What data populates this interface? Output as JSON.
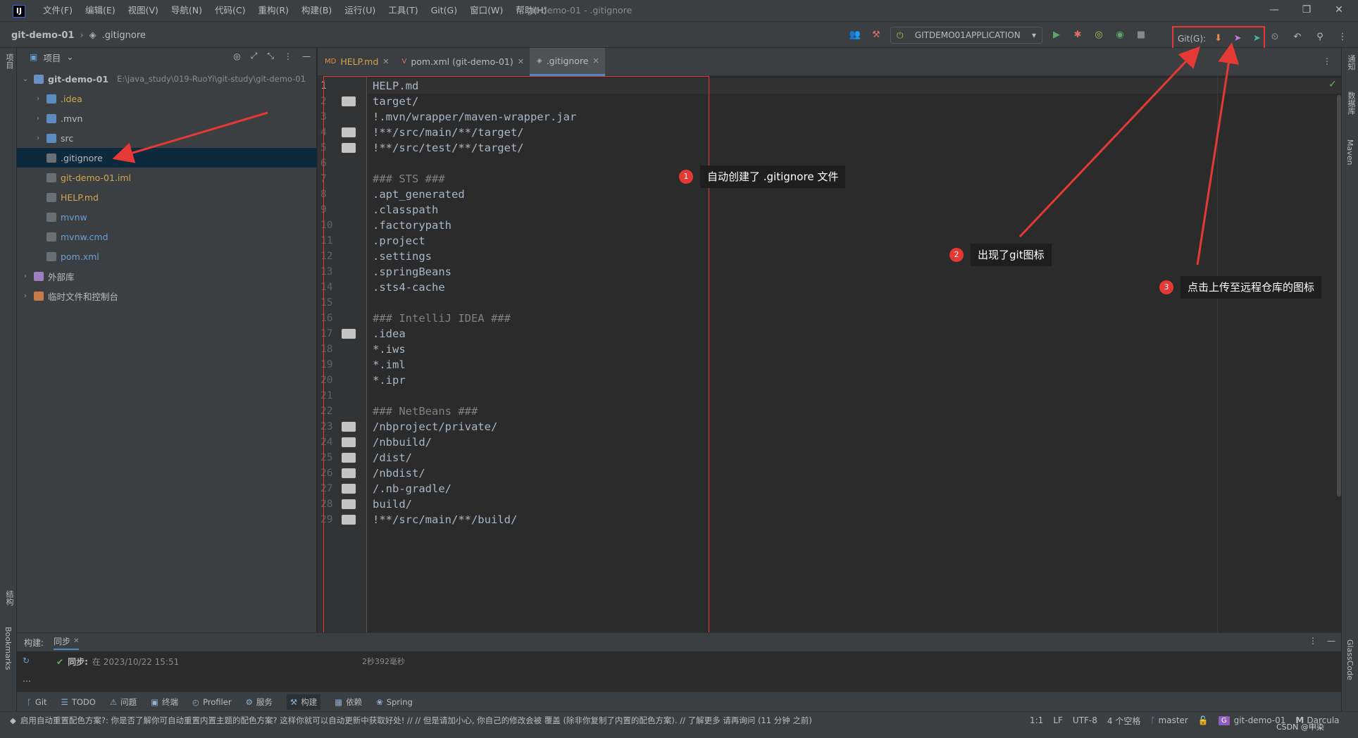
{
  "window": {
    "title": "git-demo-01 - .gitignore",
    "menu": [
      "文件(F)",
      "编辑(E)",
      "视图(V)",
      "导航(N)",
      "代码(C)",
      "重构(R)",
      "构建(B)",
      "运行(U)",
      "工具(T)",
      "Git(G)",
      "窗口(W)",
      "帮助(H)"
    ],
    "controls": {
      "minimize": "—",
      "restore": "❐",
      "close": "✕"
    }
  },
  "navbar": {
    "project": "git-demo-01",
    "file": ".gitignore",
    "run_config": "GITDEMO01APPLICATION",
    "git_label": "Git(G):"
  },
  "left_stripe": {
    "project_label": "项目",
    "structure_label": "结构",
    "bookmarks_label": "Bookmarks"
  },
  "right_stripe": {
    "notifications": "通知",
    "database": "数据库",
    "maven": "Maven",
    "glasscode": "GlassCode"
  },
  "project_panel": {
    "title": "项目",
    "root": {
      "name": "git-demo-01",
      "path": "E:\\java_study\\019-RuoYi\\git-study\\git-demo-01"
    },
    "items": [
      {
        "name": ".idea",
        "type": "folder",
        "expandable": true,
        "color": "#d0a750"
      },
      {
        "name": ".mvn",
        "type": "folder",
        "expandable": true,
        "color": "#bbbbbb"
      },
      {
        "name": "src",
        "type": "folder",
        "expandable": true,
        "color": "#bbbbbb"
      },
      {
        "name": ".gitignore",
        "type": "file",
        "expandable": false,
        "color": "#bbbbbb",
        "selected": true
      },
      {
        "name": "git-demo-01.iml",
        "type": "file",
        "expandable": false,
        "color": "#d0a750"
      },
      {
        "name": "HELP.md",
        "type": "file",
        "expandable": false,
        "color": "#d0a750"
      },
      {
        "name": "mvnw",
        "type": "file",
        "expandable": false,
        "color": "#6a9fd4"
      },
      {
        "name": "mvnw.cmd",
        "type": "file",
        "expandable": false,
        "color": "#6a9fd4"
      },
      {
        "name": "pom.xml",
        "type": "file",
        "expandable": false,
        "color": "#6a9fd4"
      }
    ],
    "external_libs": "外部库",
    "scratches": "临时文件和控制台"
  },
  "tabs": [
    {
      "label": "HELP.md",
      "active": false
    },
    {
      "label": "pom.xml (git-demo-01)",
      "active": false
    },
    {
      "label": ".gitignore",
      "active": true
    }
  ],
  "editor": {
    "lines": [
      {
        "n": "1",
        "text": "HELP.md",
        "folder": false,
        "comment": false
      },
      {
        "n": "2",
        "text": "target/",
        "folder": true,
        "comment": false
      },
      {
        "n": "3",
        "text": "!.mvn/wrapper/maven-wrapper.jar",
        "folder": false,
        "comment": false
      },
      {
        "n": "4",
        "text": "!**/src/main/**/target/",
        "folder": true,
        "comment": false
      },
      {
        "n": "5",
        "text": "!**/src/test/**/target/",
        "folder": true,
        "comment": false
      },
      {
        "n": "6",
        "text": "",
        "folder": false,
        "comment": false
      },
      {
        "n": "7",
        "text": "### STS ###",
        "folder": false,
        "comment": true
      },
      {
        "n": "8",
        "text": ".apt_generated",
        "folder": false,
        "comment": false
      },
      {
        "n": "9",
        "text": ".classpath",
        "folder": false,
        "comment": false
      },
      {
        "n": "10",
        "text": ".factorypath",
        "folder": false,
        "comment": false
      },
      {
        "n": "11",
        "text": ".project",
        "folder": false,
        "comment": false
      },
      {
        "n": "12",
        "text": ".settings",
        "folder": false,
        "comment": false
      },
      {
        "n": "13",
        "text": ".springBeans",
        "folder": false,
        "comment": false
      },
      {
        "n": "14",
        "text": ".sts4-cache",
        "folder": false,
        "comment": false
      },
      {
        "n": "15",
        "text": "",
        "folder": false,
        "comment": false
      },
      {
        "n": "16",
        "text": "### IntelliJ IDEA ###",
        "folder": false,
        "comment": true
      },
      {
        "n": "17",
        "text": ".idea",
        "folder": true,
        "comment": false
      },
      {
        "n": "18",
        "text": "*.iws",
        "folder": false,
        "comment": false
      },
      {
        "n": "19",
        "text": "*.iml",
        "folder": false,
        "comment": false
      },
      {
        "n": "20",
        "text": "*.ipr",
        "folder": false,
        "comment": false
      },
      {
        "n": "21",
        "text": "",
        "folder": false,
        "comment": false
      },
      {
        "n": "22",
        "text": "### NetBeans ###",
        "folder": false,
        "comment": true
      },
      {
        "n": "23",
        "text": "/nbproject/private/",
        "folder": true,
        "comment": false
      },
      {
        "n": "24",
        "text": "/nbbuild/",
        "folder": true,
        "comment": false
      },
      {
        "n": "25",
        "text": "/dist/",
        "folder": true,
        "comment": false
      },
      {
        "n": "26",
        "text": "/nbdist/",
        "folder": true,
        "comment": false
      },
      {
        "n": "27",
        "text": "/.nb-gradle/",
        "folder": true,
        "comment": false
      },
      {
        "n": "28",
        "text": "build/",
        "folder": true,
        "comment": false
      },
      {
        "n": "29",
        "text": "!**/src/main/**/build/",
        "folder": true,
        "comment": false
      }
    ]
  },
  "annotations": [
    {
      "num": "1",
      "text": "自动创建了 .gitignore 文件"
    },
    {
      "num": "2",
      "text": "出现了git图标"
    },
    {
      "num": "3",
      "text": "点击上传至远程仓库的图标"
    }
  ],
  "build_panel": {
    "label": "构建:",
    "tab": "同步",
    "sync_label": "同步:",
    "sync_text": "在 2023/10/22 15:51",
    "duration": "2秒392毫秒"
  },
  "tool_windows": [
    "Git",
    "TODO",
    "问题",
    "终端",
    "Profiler",
    "服务",
    "构建",
    "依赖",
    "Spring"
  ],
  "status": {
    "message": "启用自动重置配色方案?: 你是否了解你可自动重置内置主题的配色方案? 这样你就可以自动更新中获取好处! // // 但是请加小心, 你自己的修改会被 覆盖 (除非你复制了内置的配色方案). // 了解更多    请再询问 (11 分钟 之前)",
    "position": "1:1",
    "line_sep": "LF",
    "encoding": "UTF-8",
    "indent": "4 个空格",
    "branch": "master",
    "project": "git-demo-01",
    "theme": "Darcula",
    "watermark": "CSDN @申染"
  },
  "colors": {
    "accent": "#4a88c7",
    "annotation_red": "#e53935",
    "selection": "#0d293e"
  }
}
